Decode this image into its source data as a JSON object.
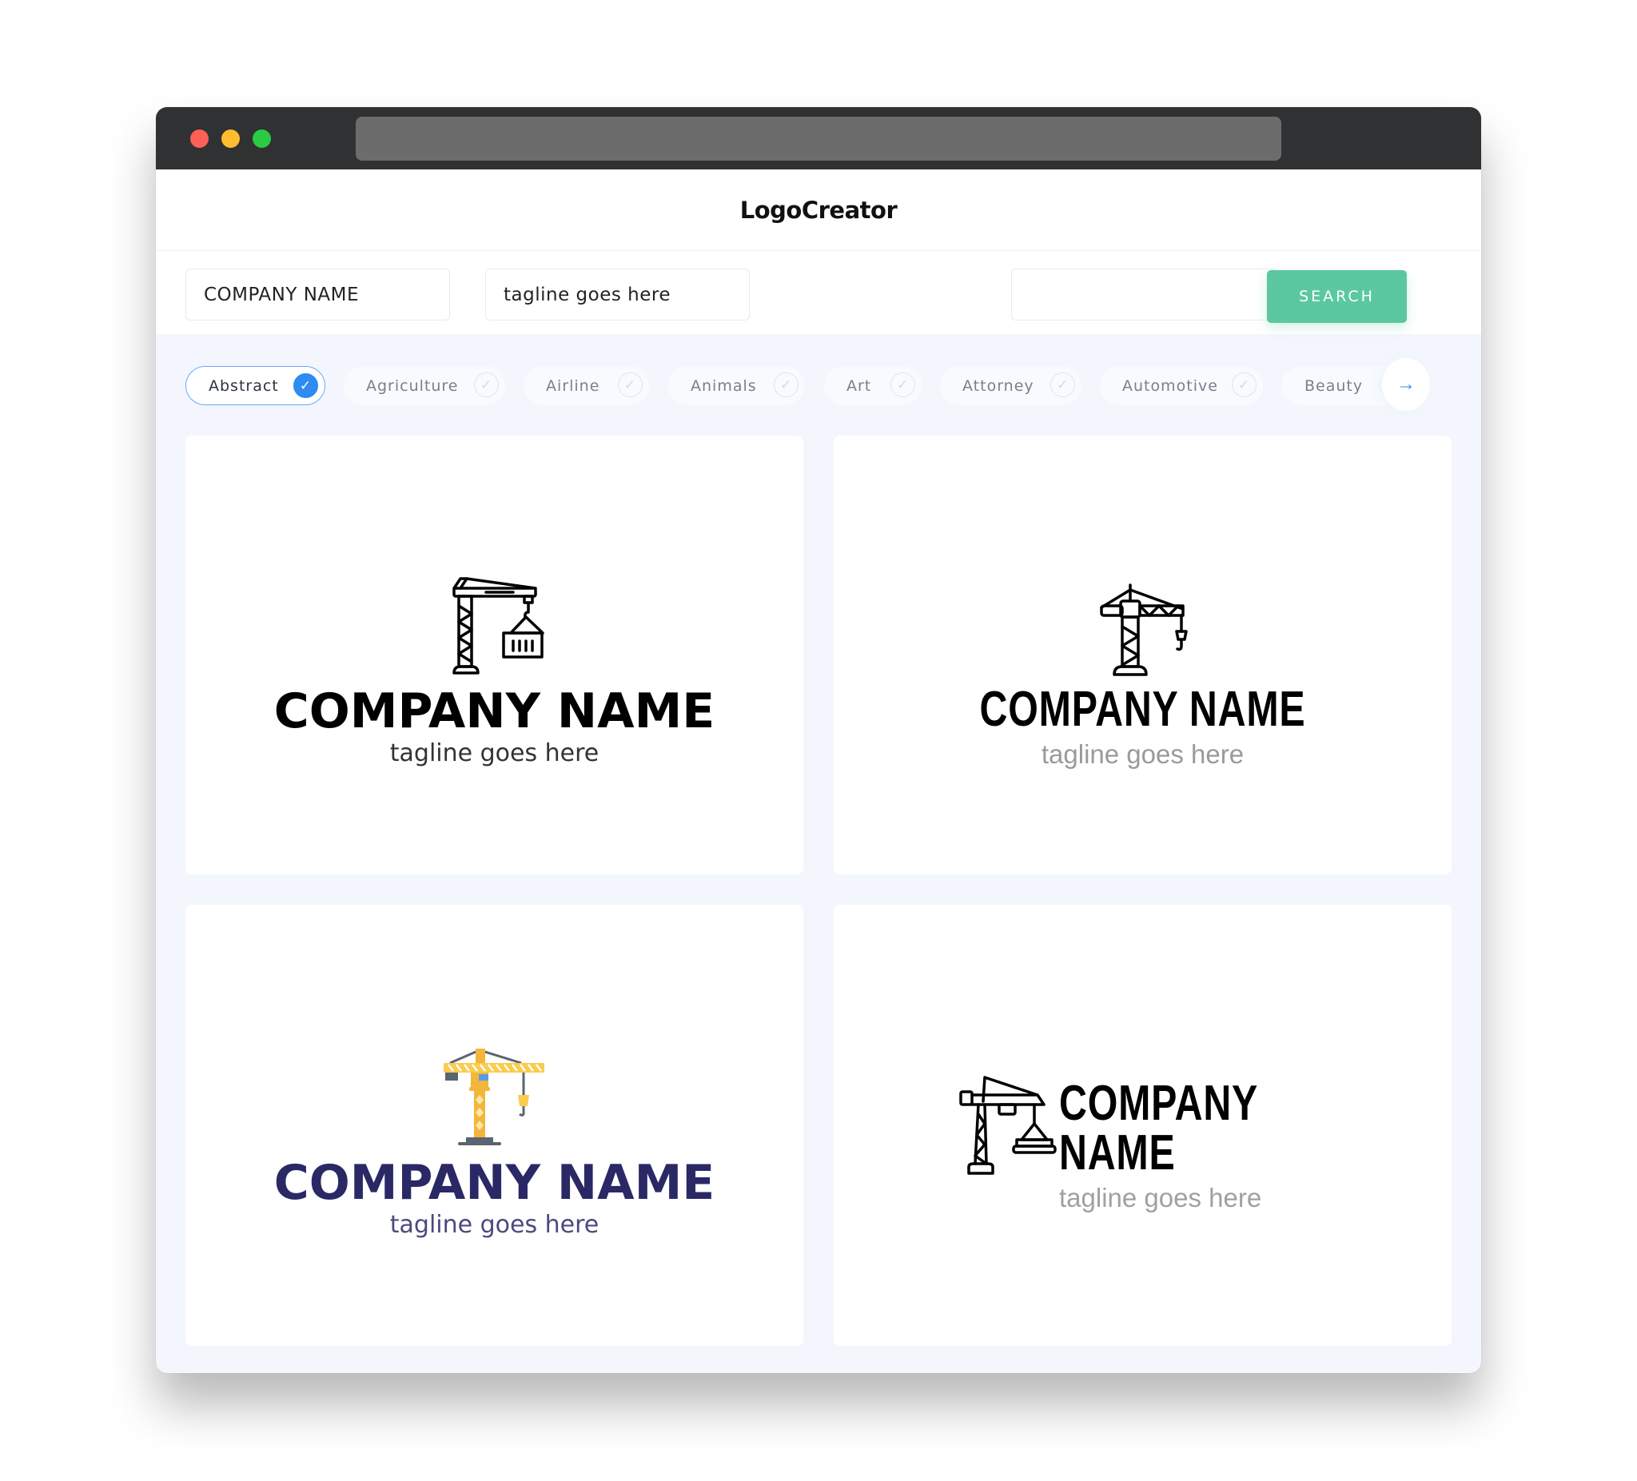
{
  "window": {
    "controls": [
      "close",
      "minimize",
      "maximize"
    ]
  },
  "header": {
    "title": "LogoCreator"
  },
  "toolbar": {
    "company_name_value": "COMPANY NAME",
    "tagline_value": "tagline goes here",
    "extra_value": "",
    "search_label": "SEARCH"
  },
  "categories": {
    "items": [
      {
        "label": "Abstract",
        "selected": true
      },
      {
        "label": "Agriculture",
        "selected": false
      },
      {
        "label": "Airline",
        "selected": false
      },
      {
        "label": "Animals",
        "selected": false
      },
      {
        "label": "Art",
        "selected": false
      },
      {
        "label": "Attorney",
        "selected": false
      },
      {
        "label": "Automotive",
        "selected": false
      },
      {
        "label": "Beauty",
        "selected": false
      }
    ],
    "check_icon": "✓",
    "next_icon": "→"
  },
  "logos": [
    {
      "company": "COMPANY NAME",
      "tagline": "tagline goes here",
      "icon": "crane-with-container-icon",
      "name_color": "#000000",
      "tagline_color": "#333333"
    },
    {
      "company": "COMPANY NAME",
      "tagline": "tagline goes here",
      "icon": "tower-crane-hook-icon",
      "name_color": "#000000",
      "tagline_color": "#9A9A9A"
    },
    {
      "company": "COMPANY NAME",
      "tagline": "tagline goes here",
      "icon": "yellow-tower-crane-icon",
      "name_color": "#2A2966",
      "tagline_color": "#4A4A7E"
    },
    {
      "company": "COMPANY NAME",
      "tagline": "tagline goes here",
      "icon": "crane-with-pallet-icon",
      "name_color": "#000000",
      "tagline_color": "#A0A0A0"
    }
  ],
  "colors": {
    "accent": "#5BC8A0",
    "selected": "#2E8CF0",
    "background": "#F3F6FD"
  }
}
